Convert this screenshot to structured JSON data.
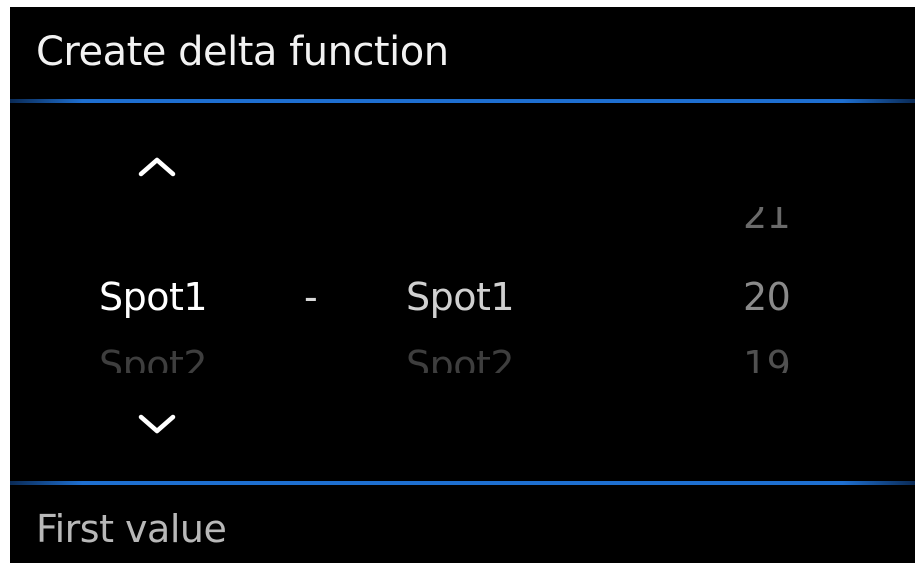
{
  "dialog": {
    "title": "Create delta function",
    "footer_label": "First value"
  },
  "colors": {
    "background": "#000000",
    "accent": "#1e6fd0",
    "text": "#ffffff"
  },
  "icons": {
    "scroll_up": "chevron-up-icon",
    "scroll_down": "chevron-down-icon"
  },
  "picker": {
    "first_value": {
      "above": "",
      "selected": "Spot1",
      "below": "Spot2"
    },
    "operator": "-",
    "second_value": {
      "above": "",
      "selected": "Spot1",
      "below": "Spot2"
    },
    "number": {
      "above": "21",
      "selected": "20",
      "below": "19"
    }
  }
}
